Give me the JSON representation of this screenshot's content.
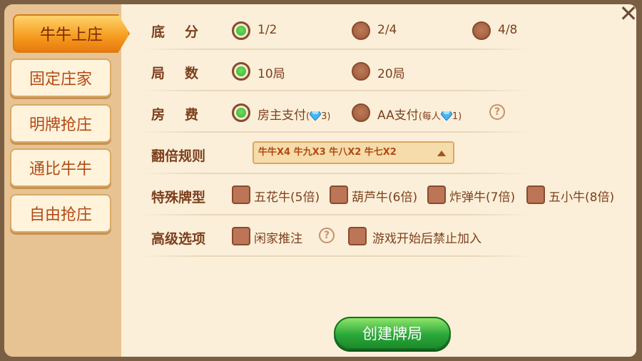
{
  "colors": {
    "accent_green": "#2aa83a",
    "text_brown": "#7c3f1d",
    "tab_orange": "#f59b1e"
  },
  "sidebar": {
    "tabs": [
      {
        "label": "牛牛上庄",
        "active": true
      },
      {
        "label": "固定庄家",
        "active": false
      },
      {
        "label": "明牌抢庄",
        "active": false
      },
      {
        "label": "通比牛牛",
        "active": false
      },
      {
        "label": "自由抢庄",
        "active": false
      }
    ]
  },
  "settings": {
    "base_score": {
      "label": "底分",
      "options": [
        "1/2",
        "2/4",
        "4/8"
      ],
      "selected": "1/2"
    },
    "rounds": {
      "label": "局数",
      "options": [
        "10局",
        "20局"
      ],
      "selected": "10局"
    },
    "room_fee": {
      "label": "房费",
      "owner_pay": {
        "text": "房主支付",
        "open": "(",
        "cost": "3",
        "close": ")"
      },
      "aa_pay": {
        "text": "AA支付",
        "open": "(每人",
        "cost": "1",
        "close": ")"
      },
      "selected": "房主支付"
    },
    "double_rule": {
      "label": "翻倍规则",
      "value": "牛牛X4 牛九X3 牛八X2 牛七X2"
    },
    "special": {
      "label": "特殊牌型",
      "options": [
        "五花牛(5倍)",
        "葫芦牛(6倍)",
        "炸弹牛(7倍)",
        "五小牛(8倍)"
      ]
    },
    "advanced": {
      "label": "高级选项",
      "options": [
        "闲家推注",
        "游戏开始后禁止加入"
      ]
    }
  },
  "buttons": {
    "help": "?",
    "close": "✕",
    "create": "创建牌局"
  }
}
